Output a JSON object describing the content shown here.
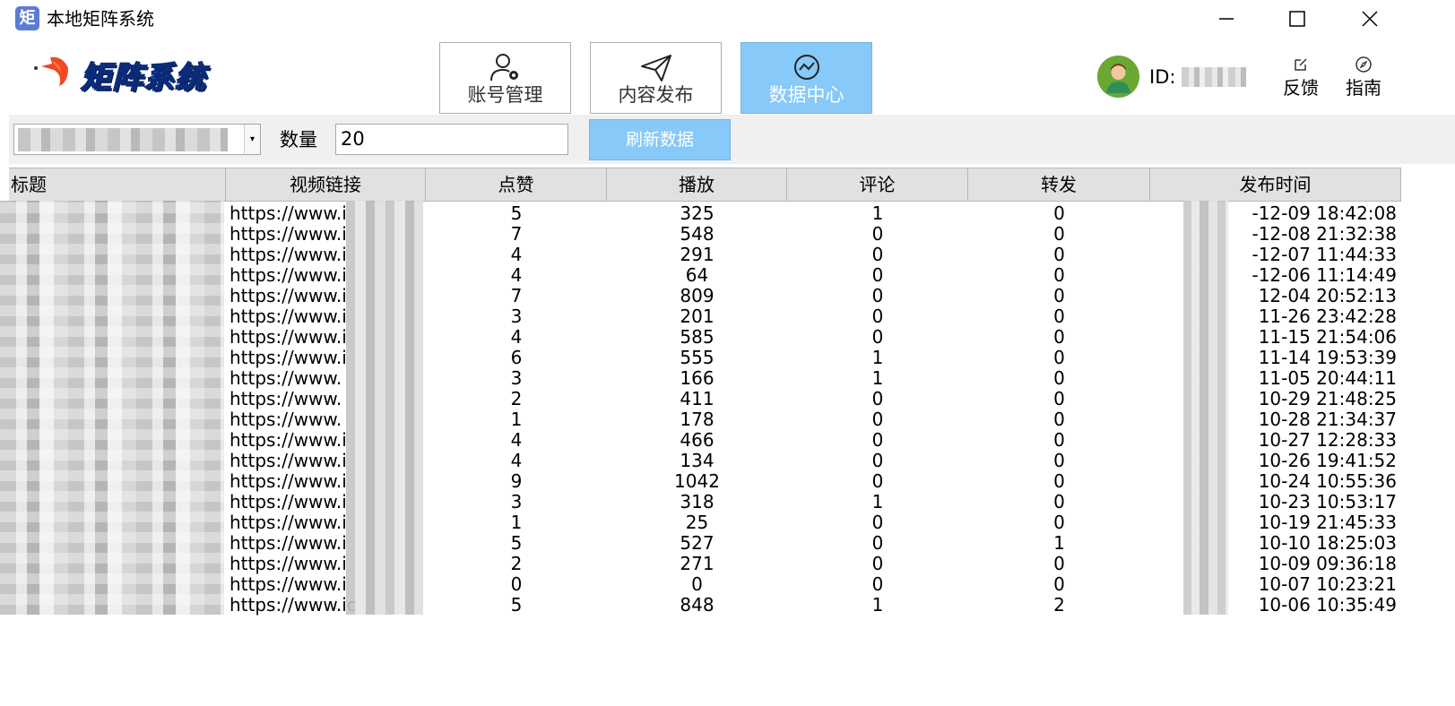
{
  "window": {
    "icon_char": "矩",
    "title": "本地矩阵系统"
  },
  "header": {
    "logo_text": "矩阵系统",
    "nav": [
      {
        "label": "账号管理",
        "icon": "user-gear-icon",
        "active": false
      },
      {
        "label": "内容发布",
        "icon": "paper-plane-icon",
        "active": false
      },
      {
        "label": "数据中心",
        "icon": "chart-line-icon",
        "active": true
      }
    ],
    "id_label": "ID:",
    "feedback_label": "反馈",
    "guide_label": "指南",
    "accent_color": "#87c9f8"
  },
  "toolbar": {
    "quantity_label": "数量",
    "quantity_value": "20",
    "refresh_label": "刷新数据"
  },
  "table": {
    "columns": [
      "标题",
      "视频链接",
      "点赞",
      "播放",
      "评论",
      "转发",
      "发布时间"
    ],
    "rows": [
      {
        "link": "https://www.i",
        "likes": "5",
        "plays": "325",
        "comments": "1",
        "shares": "0",
        "time": "-12-09 18:42:08"
      },
      {
        "link": "https://www.i",
        "likes": "7",
        "plays": "548",
        "comments": "0",
        "shares": "0",
        "time": "-12-08 21:32:38"
      },
      {
        "link": "https://www.i",
        "likes": "4",
        "plays": "291",
        "comments": "0",
        "shares": "0",
        "time": "-12-07 11:44:33"
      },
      {
        "link": "https://www.i",
        "likes": "4",
        "plays": "64",
        "comments": "0",
        "shares": "0",
        "time": "-12-06 11:14:49"
      },
      {
        "link": "https://www.i",
        "likes": "7",
        "plays": "809",
        "comments": "0",
        "shares": "0",
        "time": "12-04 20:52:13"
      },
      {
        "link": "https://www.i",
        "likes": "3",
        "plays": "201",
        "comments": "0",
        "shares": "0",
        "time": "11-26 23:42:28"
      },
      {
        "link": "https://www.i",
        "likes": "4",
        "plays": "585",
        "comments": "0",
        "shares": "0",
        "time": "11-15 21:54:06"
      },
      {
        "link": "https://www.i",
        "likes": "6",
        "plays": "555",
        "comments": "1",
        "shares": "0",
        "time": "11-14 19:53:39"
      },
      {
        "link": "https://www.",
        "likes": "3",
        "plays": "166",
        "comments": "1",
        "shares": "0",
        "time": "11-05 20:44:11"
      },
      {
        "link": "https://www.",
        "likes": "2",
        "plays": "411",
        "comments": "0",
        "shares": "0",
        "time": "10-29 21:48:25"
      },
      {
        "link": "https://www.",
        "likes": "1",
        "plays": "178",
        "comments": "0",
        "shares": "0",
        "time": "10-28 21:34:37"
      },
      {
        "link": "https://www.i",
        "likes": "4",
        "plays": "466",
        "comments": "0",
        "shares": "0",
        "time": "10-27 12:28:33"
      },
      {
        "link": "https://www.i",
        "likes": "4",
        "plays": "134",
        "comments": "0",
        "shares": "0",
        "time": "10-26 19:41:52"
      },
      {
        "link": "https://www.i",
        "likes": "9",
        "plays": "1042",
        "comments": "0",
        "shares": "0",
        "time": "10-24 10:55:36"
      },
      {
        "link": "https://www.i",
        "likes": "3",
        "plays": "318",
        "comments": "1",
        "shares": "0",
        "time": "10-23 10:53:17"
      },
      {
        "link": "https://www.i",
        "likes": "1",
        "plays": "25",
        "comments": "0",
        "shares": "0",
        "time": "10-19 21:45:33"
      },
      {
        "link": "https://www.i",
        "likes": "5",
        "plays": "527",
        "comments": "0",
        "shares": "1",
        "time": "10-10 18:25:03"
      },
      {
        "link": "https://www.i",
        "likes": "2",
        "plays": "271",
        "comments": "0",
        "shares": "0",
        "time": "10-09 09:36:18"
      },
      {
        "link": "https://www.i",
        "likes": "0",
        "plays": "0",
        "comments": "0",
        "shares": "0",
        "time": "10-07 10:23:21"
      },
      {
        "link": "https://www.ic",
        "likes": "5",
        "plays": "848",
        "comments": "1",
        "shares": "2",
        "time": "10-06 10:35:49"
      }
    ]
  }
}
